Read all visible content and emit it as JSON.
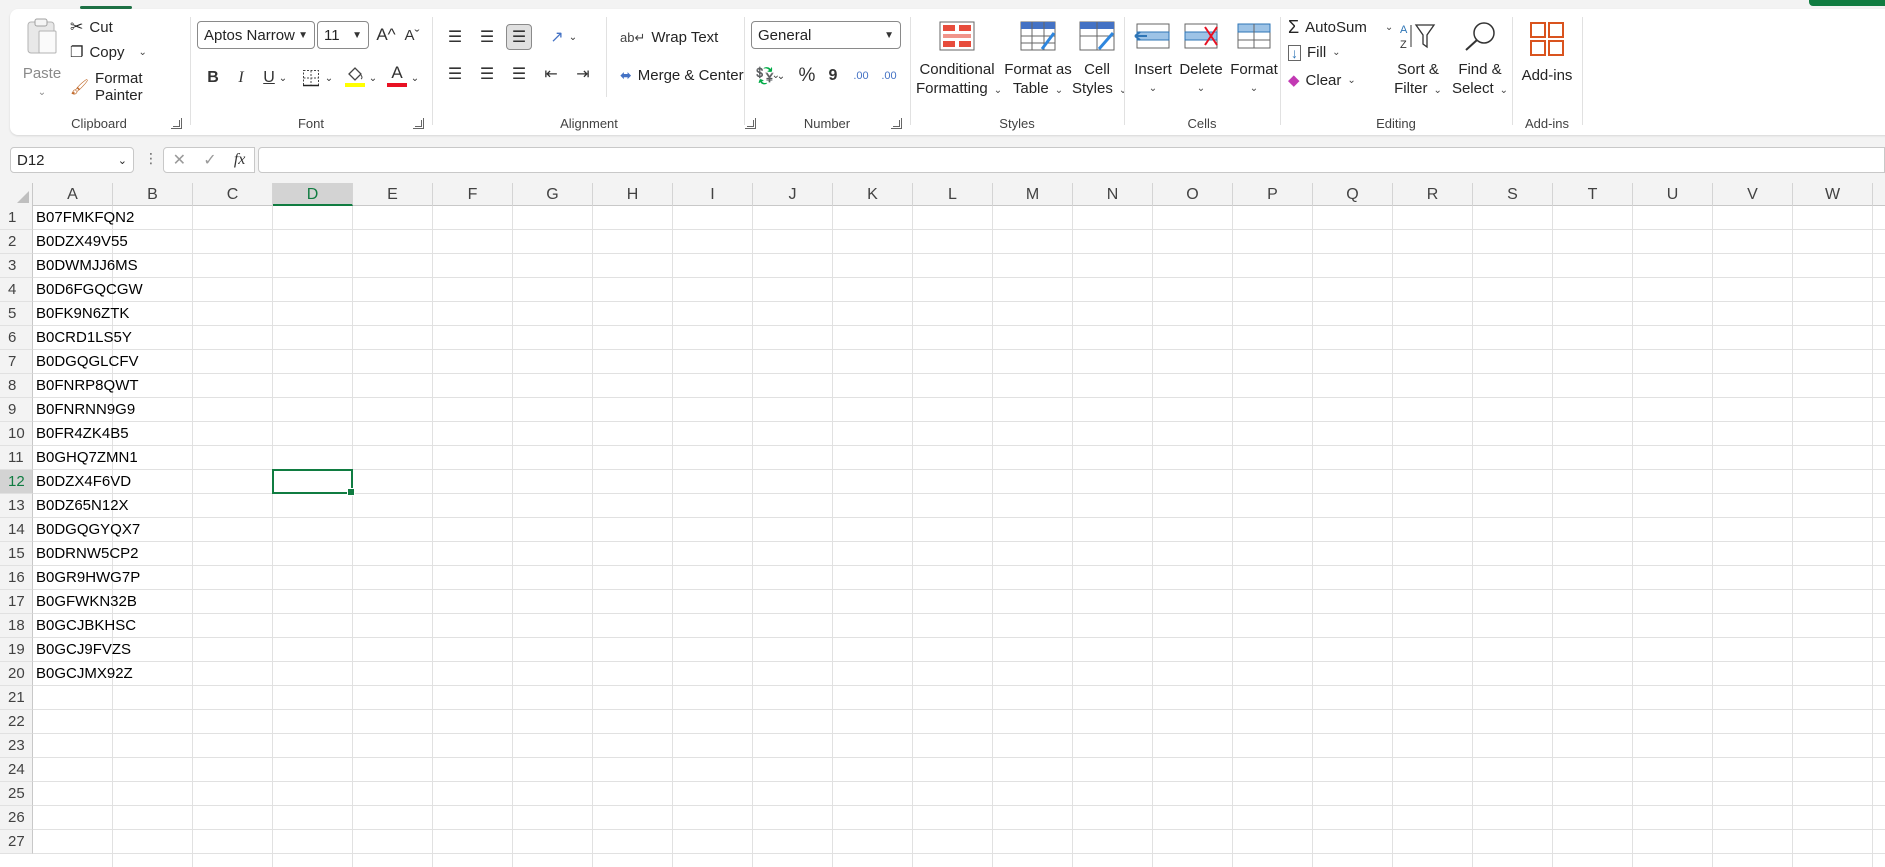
{
  "ribbon": {
    "clipboard": {
      "paste": "Paste",
      "cut": "Cut",
      "copy": "Copy",
      "format_painter": "Format Painter",
      "label": "Clipboard"
    },
    "font": {
      "name": "Aptos Narrow",
      "size": "11",
      "label": "Font",
      "bold": "B",
      "italic": "I",
      "underline": "U",
      "grow": "A^",
      "shrink": "Aˇ",
      "font_color_letter": "A"
    },
    "alignment": {
      "wrap_text": "Wrap Text",
      "merge_center": "Merge & Center",
      "label": "Alignment"
    },
    "number": {
      "format": "General",
      "label": "Number",
      "percent": "%",
      "comma": "9",
      "inc_decimal": ".00",
      "dec_decimal": ".00"
    },
    "styles": {
      "conditional": [
        "Conditional",
        "Formatting"
      ],
      "format_table": [
        "Format as",
        "Table"
      ],
      "cell_styles": [
        "Cell",
        "Styles"
      ],
      "label": "Styles"
    },
    "cells": {
      "insert": "Insert",
      "delete": "Delete",
      "format": "Format",
      "label": "Cells"
    },
    "editing": {
      "autosum": "AutoSum",
      "fill": "Fill",
      "clear": "Clear",
      "sort_filter": [
        "Sort &",
        "Filter"
      ],
      "find_select": [
        "Find &",
        "Select"
      ],
      "label": "Editing"
    },
    "addins": {
      "addins": "Add-ins",
      "label": "Add-ins"
    }
  },
  "formula_bar": {
    "name_box": "D12",
    "fx": "fx",
    "formula": ""
  },
  "grid": {
    "columns": [
      "A",
      "B",
      "C",
      "D",
      "E",
      "F",
      "G",
      "H",
      "I",
      "J",
      "K",
      "L",
      "M",
      "N",
      "O",
      "P",
      "Q",
      "R",
      "S",
      "T",
      "U",
      "V",
      "W"
    ],
    "rows": [
      "1",
      "2",
      "3",
      "4",
      "5",
      "6",
      "7",
      "8",
      "9",
      "10",
      "11",
      "12",
      "13",
      "14",
      "15",
      "16",
      "17",
      "18",
      "19",
      "20",
      "21",
      "22",
      "23",
      "24",
      "25",
      "26",
      "27"
    ],
    "active_column": "D",
    "active_row": "12",
    "column_a_values": [
      "B07FMKFQN2",
      "B0DZX49V55",
      "B0DWMJJ6MS",
      "B0D6FGQCGW",
      "B0FK9N6ZTK",
      "B0CRD1LS5Y",
      "B0DGQGLCFV",
      "B0FNRP8QWT",
      "B0FNRNN9G9",
      "B0FR4ZK4B5",
      "B0GHQ7ZMN1",
      "B0DZX4F6VD",
      "B0DZ65N12X",
      "B0DGQGYQX7",
      "B0DRNW5CP2",
      "B0GR9HWG7P",
      "B0GFWKN32B",
      "B0GCJBKHSC",
      "B0GCJ9FVZS",
      "B0GCJMX92Z"
    ]
  },
  "colors": {
    "accent": "#107c41",
    "ribbon_bg": "#ffffff",
    "app_bg": "#f3f3f3"
  }
}
